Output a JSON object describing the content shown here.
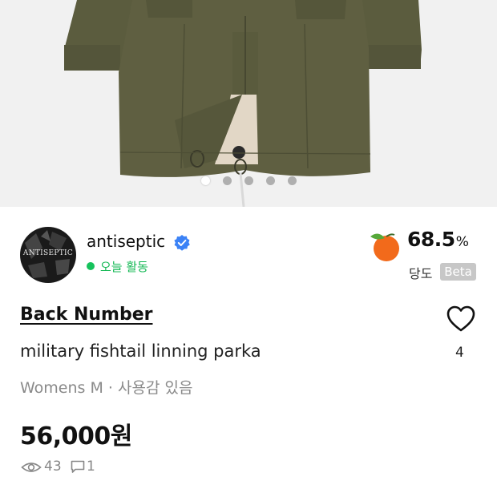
{
  "product_photo": {
    "image_count": 5,
    "active_index": 0
  },
  "seller": {
    "name": "antiseptic",
    "avatar_text": "ANTISEPTIC",
    "status": "오늘 활동",
    "status_color": "#16c25c",
    "verified_color": "#3b82f6"
  },
  "score": {
    "value": "68.5",
    "unit": "%",
    "label": "당도",
    "badge": "Beta",
    "fruit_icon": "peach-icon"
  },
  "product": {
    "brand": "Back Number",
    "title": "military fishtail linning parka",
    "meta": "Womens M · 사용감 있음",
    "price": "56,000원"
  },
  "likes": {
    "count": "4",
    "icon": "heart-icon"
  },
  "stats": {
    "views": "43",
    "comments": "1"
  }
}
